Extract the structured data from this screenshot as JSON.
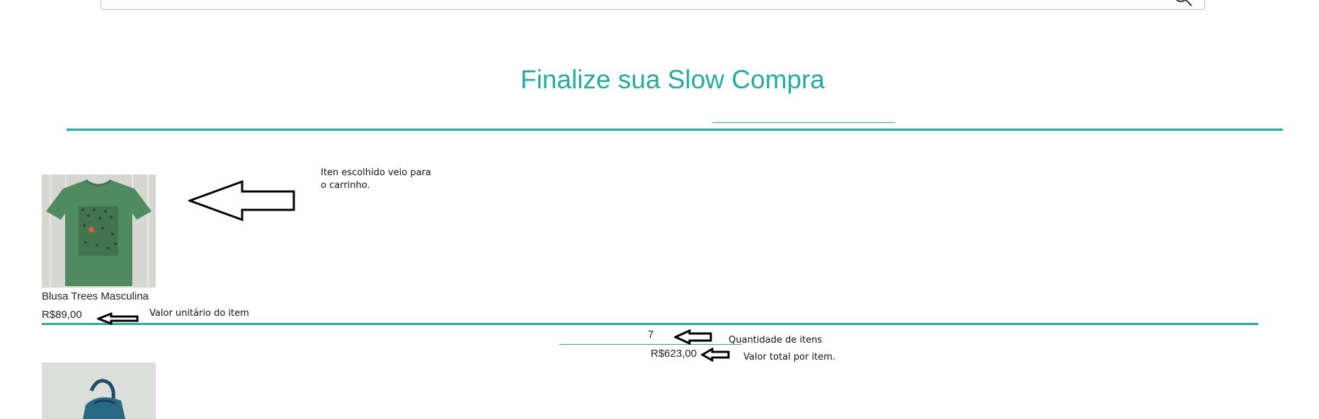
{
  "header": {
    "page_title": "Finalize sua Slow Compra"
  },
  "cart": {
    "items": [
      {
        "name": "Blusa Trees Masculina",
        "unit_price": "R$89,00",
        "quantity": "7",
        "line_total": "R$623,00",
        "image_icon": "green-tshirt-image"
      },
      {
        "image_icon": "blue-bag-image"
      }
    ]
  },
  "annotations": {
    "cart_note": "Iten escolhido veio para o carrinho.",
    "unit_price_note": "Valor unitário do item",
    "quantity_note": "Quantidade de itens",
    "line_total_note": "Valor total por item."
  },
  "colors": {
    "accent": "#26aba1",
    "text": "#222222",
    "border": "#bdbdbd"
  }
}
